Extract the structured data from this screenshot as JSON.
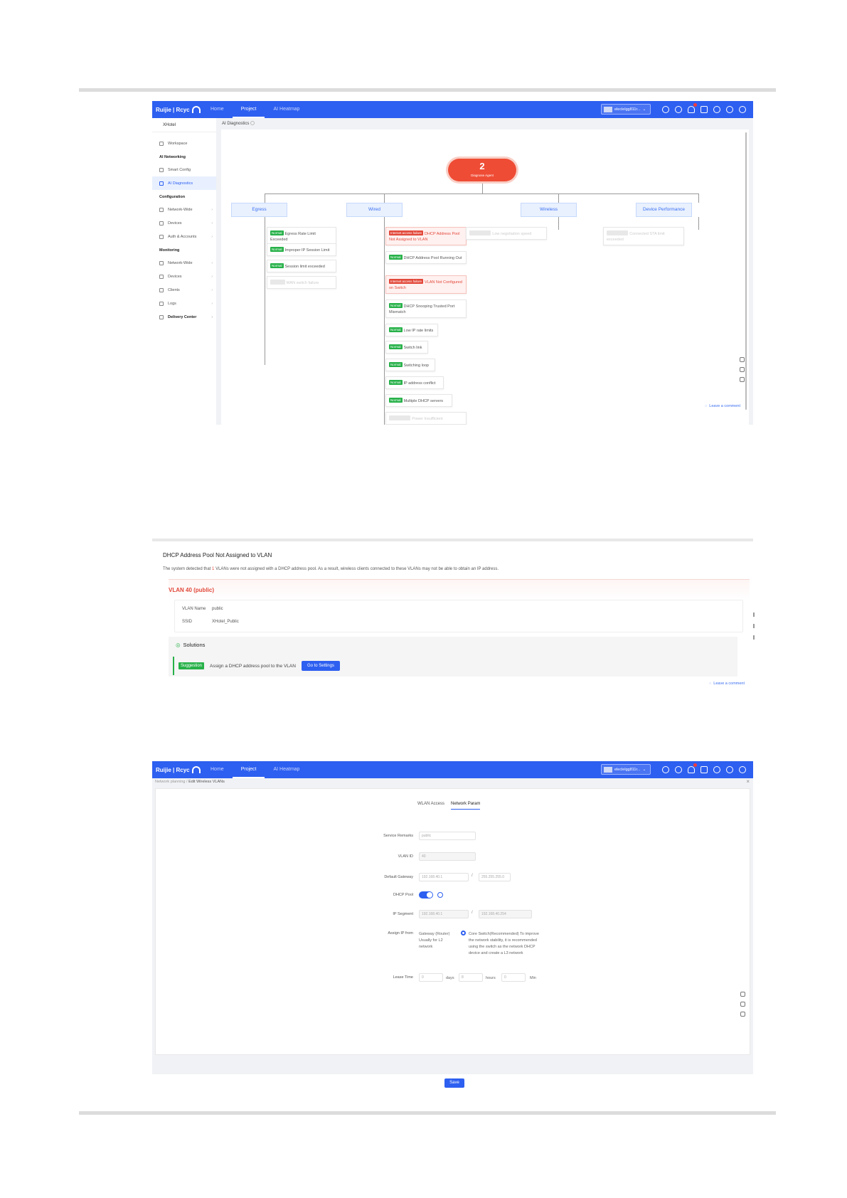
{
  "app": {
    "brand": "Ruijie | Rcyc",
    "nav": [
      "Home",
      "Project",
      "AI Heatmap"
    ],
    "project_selector": "eleclelgg811r...",
    "project_selector_3": "eleclelgg811r..."
  },
  "sidebar": {
    "project": "XHotel",
    "items": {
      "workspace": "Workspace",
      "ai_networking": "AI Networking",
      "smart_config": "Smart Config",
      "ai_diagnostics": "AI Diagnostics",
      "configuration": "Configuration",
      "network_wide": "Network-Wide",
      "devices": "Devices",
      "auth_accounts": "Auth & Accounts",
      "monitoring": "Monitoring",
      "network_wide_mon": "Network-Wide",
      "devices_mon": "Devices",
      "clients": "Clients",
      "logs": "Logs",
      "delivery_center": "Delivery Center"
    }
  },
  "diagnostics": {
    "page_title": "AI Diagnostics",
    "agent_count": "2",
    "agent_label": "Diagnose Agent",
    "categories": [
      "Egress",
      "Wired",
      "Wireless",
      "Device Performance"
    ],
    "egress": [
      {
        "tag": "Normal",
        "text": "Egress Rate Limit Exceeded"
      },
      {
        "tag": "Normal",
        "text": "Improper IP Session Limit"
      },
      {
        "tag": "Normal",
        "text": "Session limit exceeded"
      },
      {
        "tag": "",
        "text": "WAN switch failure"
      }
    ],
    "wired": [
      {
        "tag": "Internet access failure",
        "text": "DHCP Address Pool Not Assigned to VLAN"
      },
      {
        "tag": "Normal",
        "text": "DHCP Address Pool Running Out"
      },
      {
        "tag": "Internet access failure",
        "text": "VLAN Not Configured on Switch"
      },
      {
        "tag": "Normal",
        "text": "DHCP Snooping Trusted Port Mismatch"
      },
      {
        "tag": "Normal",
        "text": "Low IP rate limits"
      },
      {
        "tag": "Normal",
        "text": "Switch link"
      },
      {
        "tag": "Normal",
        "text": "Switching loop"
      },
      {
        "tag": "Normal",
        "text": "IP address conflict"
      },
      {
        "tag": "Normal",
        "text": "Multiple DHCP servers"
      },
      {
        "tag": "",
        "text": "Power Insufficient"
      }
    ],
    "wireless": [
      {
        "tag": "",
        "text": "Low negotiation speed"
      }
    ],
    "device_performance": [
      {
        "tag": "",
        "text": "Connected STA limit exceeded"
      }
    ],
    "leave_comment": "Leave a comment"
  },
  "detail": {
    "title": "DHCP Address Pool Not Assigned to VLAN",
    "desc_prefix": "The system detected that",
    "desc_count": "1",
    "desc_suffix": "VLANs were not assigned with a DHCP address pool. As a result, wireless clients connected to these VLANs may not be able to obtain an IP address.",
    "vlan_title": "VLAN 40 (public)",
    "vlan_name_label": "VLAN Name",
    "vlan_name_value": "public",
    "ssid_label": "SSID",
    "ssid_value": "XHotel_Public",
    "solutions": "Solutions",
    "suggestion_tag": "Suggestion",
    "suggestion_text": "Assign a DHCP address pool to the VLAN",
    "go_settings": "Go to Settings",
    "leave_comment": "Leave a comment"
  },
  "edit_vlan": {
    "breadcrumb_parent": "Network planning",
    "breadcrumb_current": "Edit Wireless VLANs",
    "tabs": [
      "WLAN Access",
      "Network Param"
    ],
    "service_remarks_label": "Service Remarks",
    "service_remarks_value": "public",
    "vlan_id_label": "VLAN ID",
    "vlan_id_value": "40",
    "gateway_label": "Default Gateway",
    "gateway_value": "192.168.40.1",
    "mask_value": "255.255.255.0",
    "dhcp_pool_label": "DHCP Pool",
    "ip_segment_label": "IP Segment",
    "ip_start": "192.168.40.1",
    "ip_end": "192.168.40.254",
    "assign_ip_label": "Assign IP from",
    "option_gateway": "Gateway (Router) Usually for L2 network",
    "option_core": "Core Switch(Recommended) To improve the network stability, it is recommended using the switch as the network DHCP device and create a L3 network",
    "lease_label": "Lease Time",
    "lease_days": "0",
    "lease_days_unit": "days",
    "lease_hours": "8",
    "lease_hours_unit": "hours",
    "lease_min": "0",
    "lease_min_unit": "Min",
    "save": "Save"
  }
}
